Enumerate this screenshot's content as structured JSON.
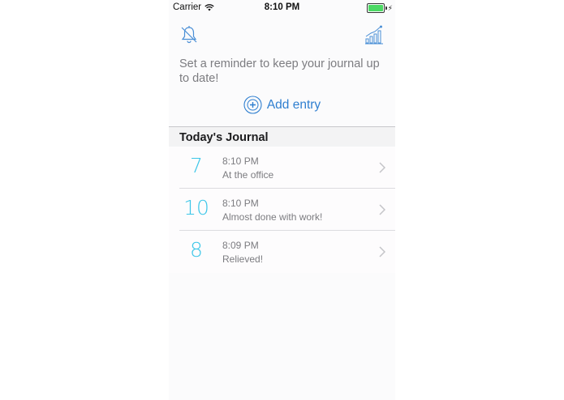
{
  "status_bar": {
    "carrier": "Carrier",
    "time": "8:10 PM",
    "battery_level": 1.0,
    "battery_color": "#4cd964"
  },
  "toolbar": {
    "left_icon": "bell-slash-icon",
    "right_icon": "bar-chart-icon"
  },
  "reminder": {
    "text": "Set a reminder to keep your journal up to date!"
  },
  "add_entry": {
    "icon": "plus-circle-icon",
    "label": "Add entry"
  },
  "journal": {
    "section_title": "Today's Journal",
    "entries": [
      {
        "rating": "7",
        "time": "8:10 PM",
        "note": "At the office"
      },
      {
        "rating": "10",
        "time": "8:10 PM",
        "note": "Almost done with work!"
      },
      {
        "rating": "8",
        "time": "8:09 PM",
        "note": "Relieved!"
      }
    ]
  },
  "colors": {
    "accent": "#2f7fd0",
    "rating": "#3cc6e8",
    "secondary_text": "#7c7c80"
  }
}
